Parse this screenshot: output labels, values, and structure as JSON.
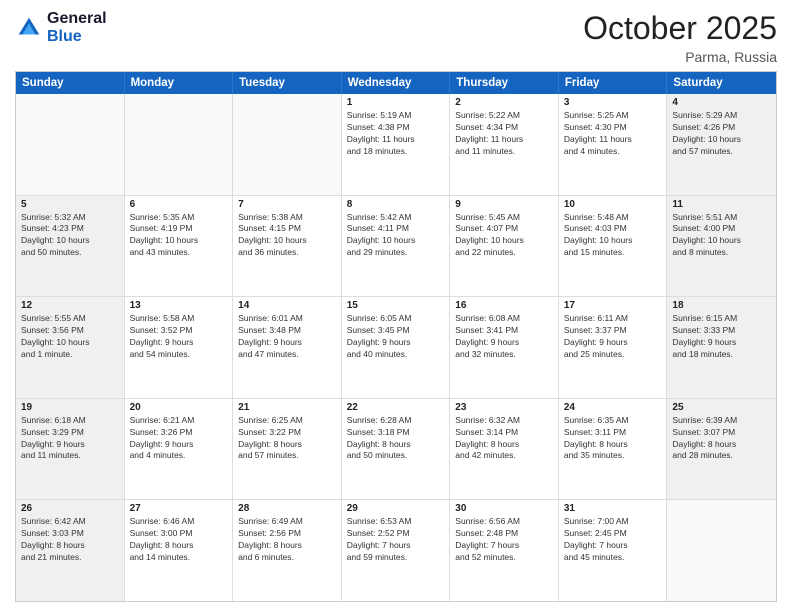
{
  "header": {
    "logo_line1": "General",
    "logo_line2": "Blue",
    "month": "October 2025",
    "location": "Parma, Russia"
  },
  "days": [
    "Sunday",
    "Monday",
    "Tuesday",
    "Wednesday",
    "Thursday",
    "Friday",
    "Saturday"
  ],
  "weeks": [
    [
      {
        "day": "",
        "info": "",
        "empty": true
      },
      {
        "day": "",
        "info": "",
        "empty": true
      },
      {
        "day": "",
        "info": "",
        "empty": true
      },
      {
        "day": "1",
        "info": "Sunrise: 5:19 AM\nSunset: 4:38 PM\nDaylight: 11 hours\nand 18 minutes."
      },
      {
        "day": "2",
        "info": "Sunrise: 5:22 AM\nSunset: 4:34 PM\nDaylight: 11 hours\nand 11 minutes."
      },
      {
        "day": "3",
        "info": "Sunrise: 5:25 AM\nSunset: 4:30 PM\nDaylight: 11 hours\nand 4 minutes."
      },
      {
        "day": "4",
        "info": "Sunrise: 5:29 AM\nSunset: 4:26 PM\nDaylight: 10 hours\nand 57 minutes.",
        "shaded": true
      }
    ],
    [
      {
        "day": "5",
        "info": "Sunrise: 5:32 AM\nSunset: 4:23 PM\nDaylight: 10 hours\nand 50 minutes.",
        "shaded": true
      },
      {
        "day": "6",
        "info": "Sunrise: 5:35 AM\nSunset: 4:19 PM\nDaylight: 10 hours\nand 43 minutes."
      },
      {
        "day": "7",
        "info": "Sunrise: 5:38 AM\nSunset: 4:15 PM\nDaylight: 10 hours\nand 36 minutes."
      },
      {
        "day": "8",
        "info": "Sunrise: 5:42 AM\nSunset: 4:11 PM\nDaylight: 10 hours\nand 29 minutes."
      },
      {
        "day": "9",
        "info": "Sunrise: 5:45 AM\nSunset: 4:07 PM\nDaylight: 10 hours\nand 22 minutes."
      },
      {
        "day": "10",
        "info": "Sunrise: 5:48 AM\nSunset: 4:03 PM\nDaylight: 10 hours\nand 15 minutes."
      },
      {
        "day": "11",
        "info": "Sunrise: 5:51 AM\nSunset: 4:00 PM\nDaylight: 10 hours\nand 8 minutes.",
        "shaded": true
      }
    ],
    [
      {
        "day": "12",
        "info": "Sunrise: 5:55 AM\nSunset: 3:56 PM\nDaylight: 10 hours\nand 1 minute.",
        "shaded": true
      },
      {
        "day": "13",
        "info": "Sunrise: 5:58 AM\nSunset: 3:52 PM\nDaylight: 9 hours\nand 54 minutes."
      },
      {
        "day": "14",
        "info": "Sunrise: 6:01 AM\nSunset: 3:48 PM\nDaylight: 9 hours\nand 47 minutes."
      },
      {
        "day": "15",
        "info": "Sunrise: 6:05 AM\nSunset: 3:45 PM\nDaylight: 9 hours\nand 40 minutes."
      },
      {
        "day": "16",
        "info": "Sunrise: 6:08 AM\nSunset: 3:41 PM\nDaylight: 9 hours\nand 32 minutes."
      },
      {
        "day": "17",
        "info": "Sunrise: 6:11 AM\nSunset: 3:37 PM\nDaylight: 9 hours\nand 25 minutes."
      },
      {
        "day": "18",
        "info": "Sunrise: 6:15 AM\nSunset: 3:33 PM\nDaylight: 9 hours\nand 18 minutes.",
        "shaded": true
      }
    ],
    [
      {
        "day": "19",
        "info": "Sunrise: 6:18 AM\nSunset: 3:29 PM\nDaylight: 9 hours\nand 11 minutes.",
        "shaded": true
      },
      {
        "day": "20",
        "info": "Sunrise: 6:21 AM\nSunset: 3:26 PM\nDaylight: 9 hours\nand 4 minutes."
      },
      {
        "day": "21",
        "info": "Sunrise: 6:25 AM\nSunset: 3:22 PM\nDaylight: 8 hours\nand 57 minutes."
      },
      {
        "day": "22",
        "info": "Sunrise: 6:28 AM\nSunset: 3:18 PM\nDaylight: 8 hours\nand 50 minutes."
      },
      {
        "day": "23",
        "info": "Sunrise: 6:32 AM\nSunset: 3:14 PM\nDaylight: 8 hours\nand 42 minutes."
      },
      {
        "day": "24",
        "info": "Sunrise: 6:35 AM\nSunset: 3:11 PM\nDaylight: 8 hours\nand 35 minutes."
      },
      {
        "day": "25",
        "info": "Sunrise: 6:39 AM\nSunset: 3:07 PM\nDaylight: 8 hours\nand 28 minutes.",
        "shaded": true
      }
    ],
    [
      {
        "day": "26",
        "info": "Sunrise: 6:42 AM\nSunset: 3:03 PM\nDaylight: 8 hours\nand 21 minutes.",
        "shaded": true
      },
      {
        "day": "27",
        "info": "Sunrise: 6:46 AM\nSunset: 3:00 PM\nDaylight: 8 hours\nand 14 minutes."
      },
      {
        "day": "28",
        "info": "Sunrise: 6:49 AM\nSunset: 2:56 PM\nDaylight: 8 hours\nand 6 minutes."
      },
      {
        "day": "29",
        "info": "Sunrise: 6:53 AM\nSunset: 2:52 PM\nDaylight: 7 hours\nand 59 minutes."
      },
      {
        "day": "30",
        "info": "Sunrise: 6:56 AM\nSunset: 2:48 PM\nDaylight: 7 hours\nand 52 minutes."
      },
      {
        "day": "31",
        "info": "Sunrise: 7:00 AM\nSunset: 2:45 PM\nDaylight: 7 hours\nand 45 minutes."
      },
      {
        "day": "",
        "info": "",
        "empty": true,
        "shaded": true
      }
    ]
  ]
}
